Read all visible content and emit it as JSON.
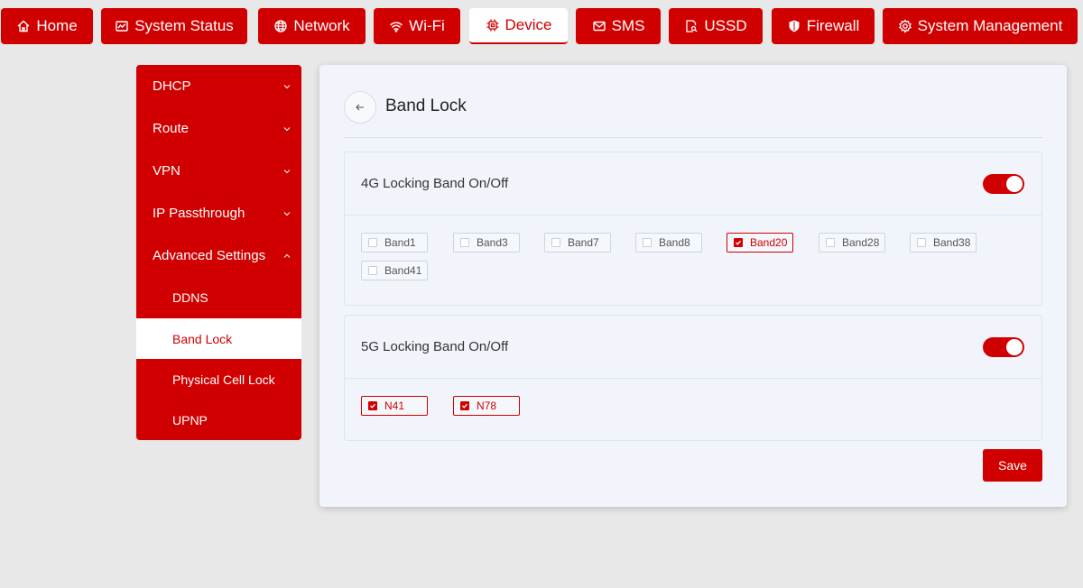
{
  "nav": {
    "items": [
      {
        "label": "Home",
        "icon": "home-icon"
      },
      {
        "label": "System Status",
        "icon": "monitor-icon"
      },
      {
        "label": "Network",
        "icon": "globe-icon"
      },
      {
        "label": "Wi-Fi",
        "icon": "wifi-icon"
      },
      {
        "label": "Device",
        "icon": "chip-icon",
        "active": true
      },
      {
        "label": "SMS",
        "icon": "mail-icon"
      },
      {
        "label": "USSD",
        "icon": "search-doc-icon"
      },
      {
        "label": "Firewall",
        "icon": "shield-icon"
      },
      {
        "label": "System Management",
        "icon": "gear-icon"
      }
    ]
  },
  "sidebar": {
    "items": [
      {
        "label": "DHCP",
        "expanded": false
      },
      {
        "label": "Route",
        "expanded": false
      },
      {
        "label": "VPN",
        "expanded": false
      },
      {
        "label": "IP Passthrough",
        "expanded": false
      },
      {
        "label": "Advanced Settings",
        "expanded": true
      }
    ],
    "subitems": [
      {
        "label": "DDNS"
      },
      {
        "label": "Band Lock",
        "active": true
      },
      {
        "label": "Physical Cell Lock"
      },
      {
        "label": "UPNP"
      }
    ]
  },
  "page": {
    "title": "Band Lock"
  },
  "lte": {
    "title": "4G Locking Band On/Off",
    "enabled": true,
    "bands": [
      {
        "label": "Band1",
        "checked": false
      },
      {
        "label": "Band3",
        "checked": false
      },
      {
        "label": "Band7",
        "checked": false
      },
      {
        "label": "Band8",
        "checked": false
      },
      {
        "label": "Band20",
        "checked": true
      },
      {
        "label": "Band28",
        "checked": false
      },
      {
        "label": "Band38",
        "checked": false
      },
      {
        "label": "Band41",
        "checked": false
      }
    ]
  },
  "nr": {
    "title": "5G Locking Band On/Off",
    "enabled": true,
    "bands": [
      {
        "label": "N41",
        "checked": true
      },
      {
        "label": "N78",
        "checked": true
      }
    ]
  },
  "actions": {
    "save_label": "Save"
  },
  "colors": {
    "accent": "#d10000",
    "background": "#e8e8e8",
    "panel": "#f1f5fb"
  }
}
